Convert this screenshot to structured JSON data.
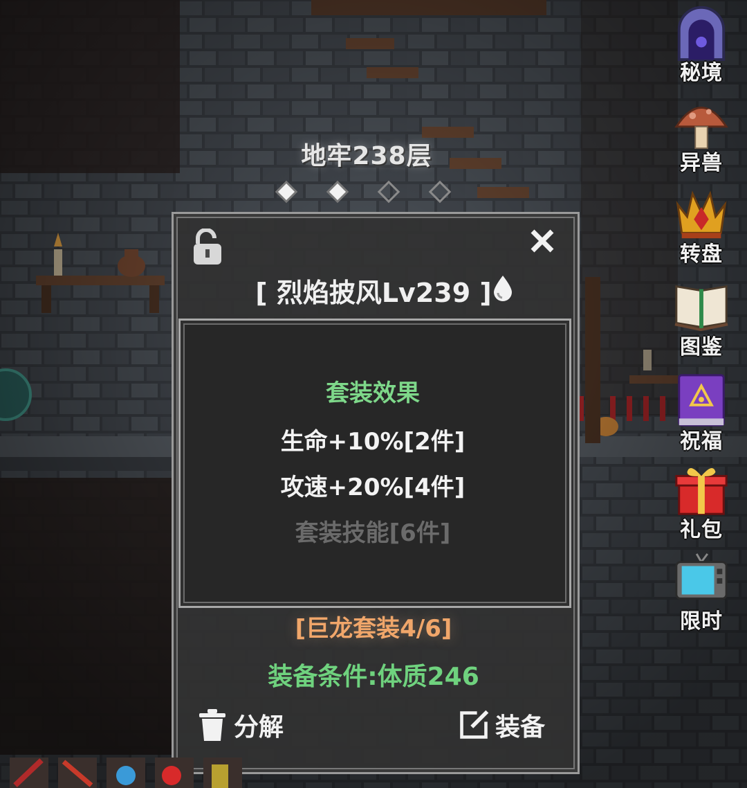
{
  "hud": {
    "floor_title": "地牢238层",
    "page_dots": [
      {
        "state": "filled"
      },
      {
        "state": "filled"
      },
      {
        "state": "empty"
      },
      {
        "state": "empty"
      }
    ]
  },
  "side_menu": [
    {
      "label": "秘境",
      "icon": "portal-gate-icon"
    },
    {
      "label": "异兽",
      "icon": "mushroom-icon"
    },
    {
      "label": "转盘",
      "icon": "crown-wheel-icon"
    },
    {
      "label": "图鉴",
      "icon": "open-book-icon"
    },
    {
      "label": "祝福",
      "icon": "purple-tome-icon"
    },
    {
      "label": "礼包",
      "icon": "gift-box-icon"
    },
    {
      "label": "限时",
      "icon": "tv-icon"
    }
  ],
  "item_panel": {
    "item_name": "[ 烈焰披风Lv239 ]",
    "lock_icon": "unlock-icon",
    "close_icon": "close-icon",
    "element_icon": "water-drop-icon",
    "set_effects": {
      "title": "套装效果",
      "lines": [
        {
          "text": "生命+10%[2件]",
          "active": true
        },
        {
          "text": "攻速+20%[4件]",
          "active": true
        },
        {
          "text": "套装技能[6件]",
          "active": false
        }
      ]
    },
    "set_name": "[巨龙套装4/6]",
    "requirement": "装备条件:体质246",
    "buttons": {
      "dismantle": "分解",
      "equip": "装备"
    }
  },
  "colors": {
    "panel_bg": "#323232",
    "set_title": "#7ed88a",
    "set_active": "#f3f3f3",
    "set_inactive": "#6b6b6b",
    "set_name": "#f0a66a",
    "requirement": "#6fd27e"
  }
}
